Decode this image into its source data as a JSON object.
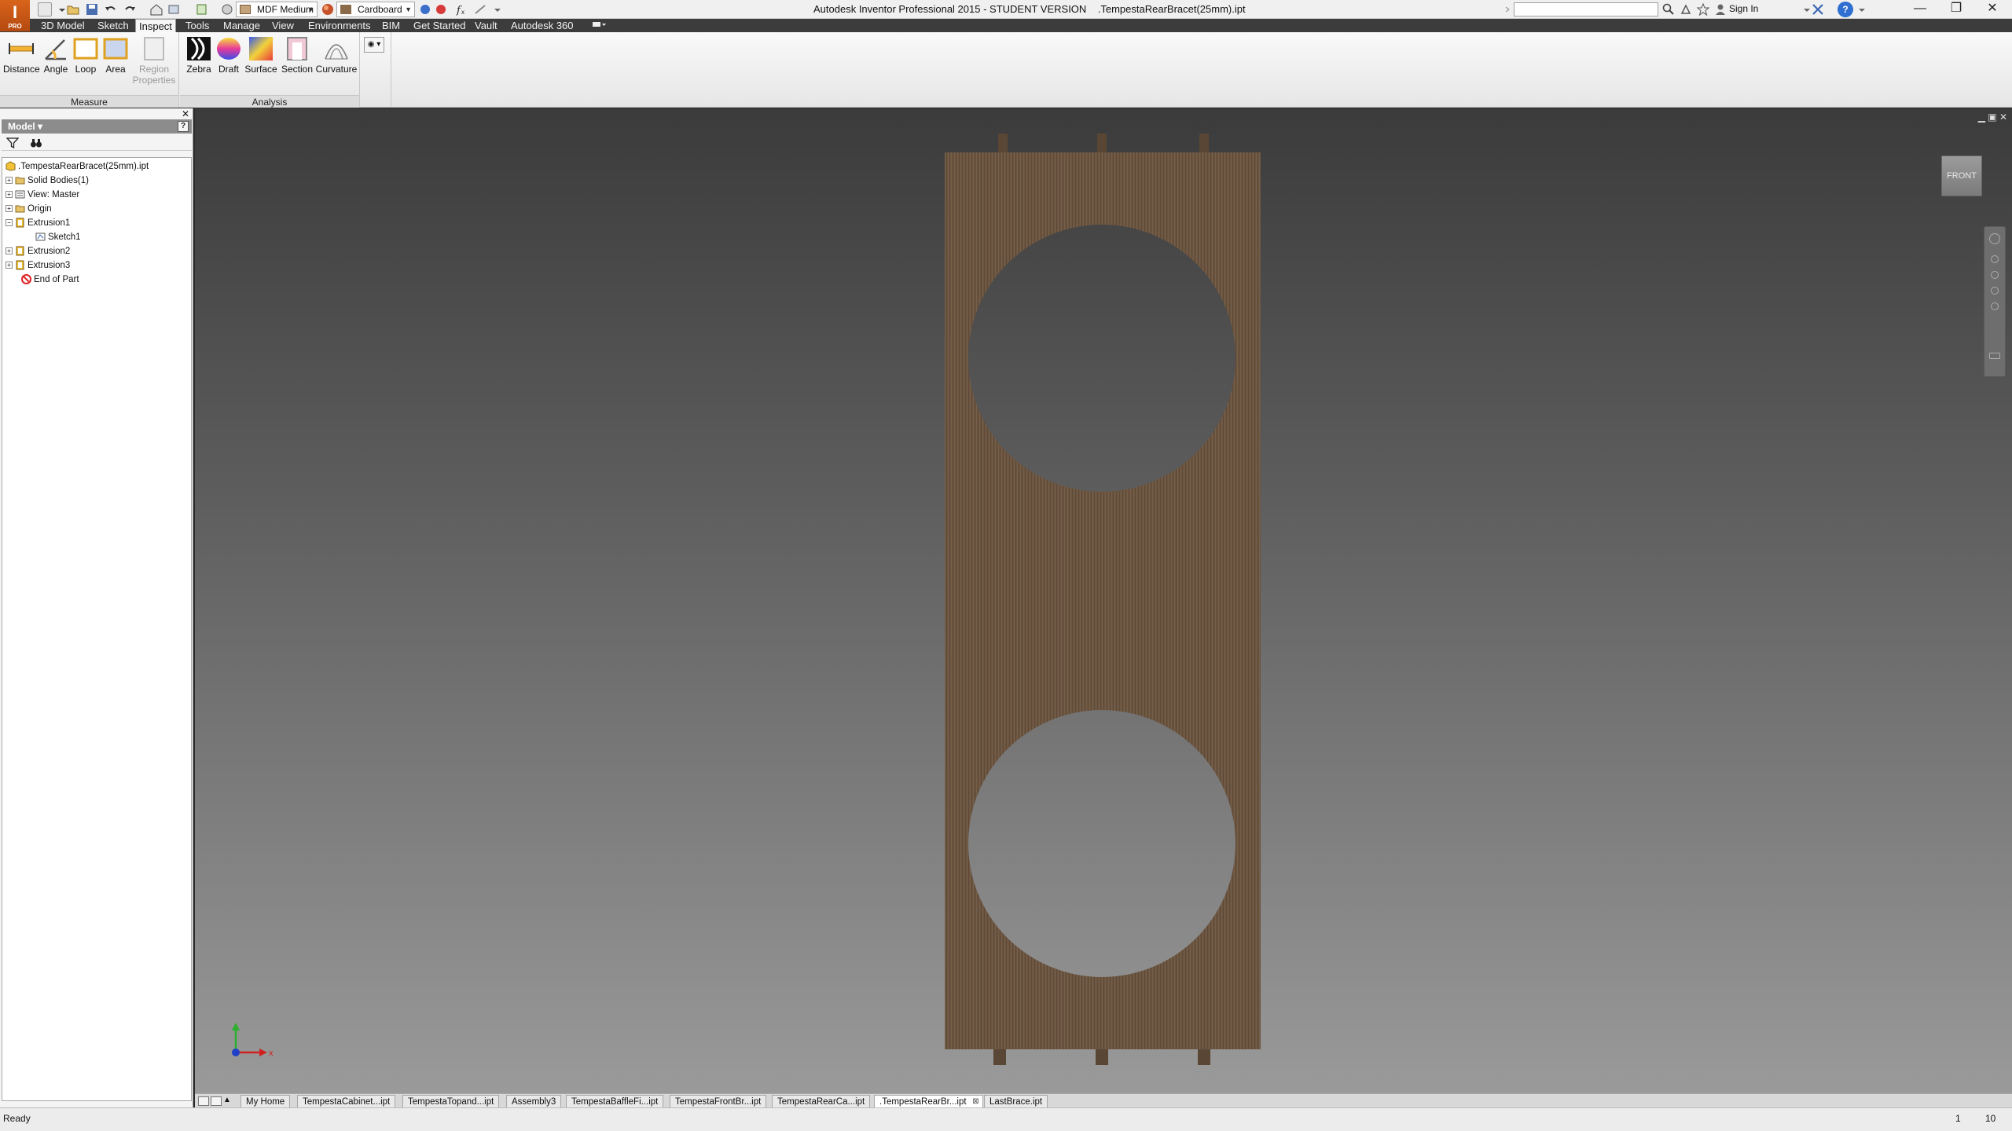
{
  "title_bar": {
    "window_title": "Autodesk Inventor Professional 2015 - STUDENT VERSION    .TempestaRearBracet(25mm).ipt",
    "app_button_letter": "I",
    "app_button_badge": "PRO",
    "material_combo": "MDF Medium",
    "appearance_combo": "Cardboard",
    "sign_in": "Sign In",
    "help": "?",
    "minimize": "—",
    "restore": "❐",
    "close": "✕"
  },
  "ribbon_tabs": [
    {
      "label": "3D Model",
      "active": false
    },
    {
      "label": "Sketch",
      "active": false
    },
    {
      "label": "Inspect",
      "active": true
    },
    {
      "label": "Tools",
      "active": false
    },
    {
      "label": "Manage",
      "active": false
    },
    {
      "label": "View",
      "active": false
    },
    {
      "label": "Environments",
      "active": false
    },
    {
      "label": "BIM",
      "active": false
    },
    {
      "label": "Get Started",
      "active": false
    },
    {
      "label": "Vault",
      "active": false
    },
    {
      "label": "Autodesk 360",
      "active": false
    }
  ],
  "ribbon": {
    "measure_panel": {
      "title": "Measure",
      "buttons": {
        "distance": "Distance",
        "angle": "Angle",
        "loop": "Loop",
        "area": "Area",
        "region_line1": "Region",
        "region_line2": "Properties"
      }
    },
    "analysis_panel": {
      "title": "Analysis",
      "buttons": {
        "zebra": "Zebra",
        "draft": "Draft",
        "surface": "Surface",
        "section": "Section",
        "curvature": "Curvature"
      }
    }
  },
  "browser": {
    "header": "Model ▾",
    "close": "✕",
    "help": "?",
    "tree": [
      {
        "label": ".TempestaRearBracet(25mm).ipt",
        "expander": "",
        "icon": "part-icon"
      },
      {
        "label": "Solid Bodies(1)",
        "expander": "+",
        "icon": "folder-icon"
      },
      {
        "label": "View: Master",
        "expander": "+",
        "icon": "view-icon"
      },
      {
        "label": "Origin",
        "expander": "+",
        "icon": "folder-icon"
      },
      {
        "label": "Extrusion1",
        "expander": "−",
        "icon": "extrusion-icon"
      },
      {
        "label": "Sketch1",
        "expander": "",
        "icon": "sketch-icon"
      },
      {
        "label": "Extrusion2",
        "expander": "+",
        "icon": "extrusion-icon"
      },
      {
        "label": "Extrusion3",
        "expander": "+",
        "icon": "extrusion-icon"
      },
      {
        "label": "End of Part",
        "expander": "",
        "icon": "end-of-part-icon"
      }
    ]
  },
  "viewport": {
    "view_cube_label": "FRONT",
    "view_controls": "▁ ▣ ✕",
    "triad_x": "x",
    "material_color": "#6b5440",
    "background_top": "#3b3b3b",
    "background_bottom": "#9a9a9a"
  },
  "document_tabs": [
    {
      "label": "My Home",
      "active": false
    },
    {
      "label": "TempestaCabinet...ipt",
      "active": false
    },
    {
      "label": "TempestaTopand...ipt",
      "active": false
    },
    {
      "label": "Assembly3",
      "active": false
    },
    {
      "label": "TempestaBaffleFi...ipt",
      "active": false
    },
    {
      "label": "TempestaFrontBr...ipt",
      "active": false
    },
    {
      "label": "TempestaRearCa...ipt",
      "active": false
    },
    {
      "label": ".TempestaRearBr...ipt",
      "active": true
    },
    {
      "label": "LastBrace.ipt",
      "active": false
    }
  ],
  "status_bar": {
    "text": "Ready",
    "value1": "1",
    "value2": "10"
  }
}
